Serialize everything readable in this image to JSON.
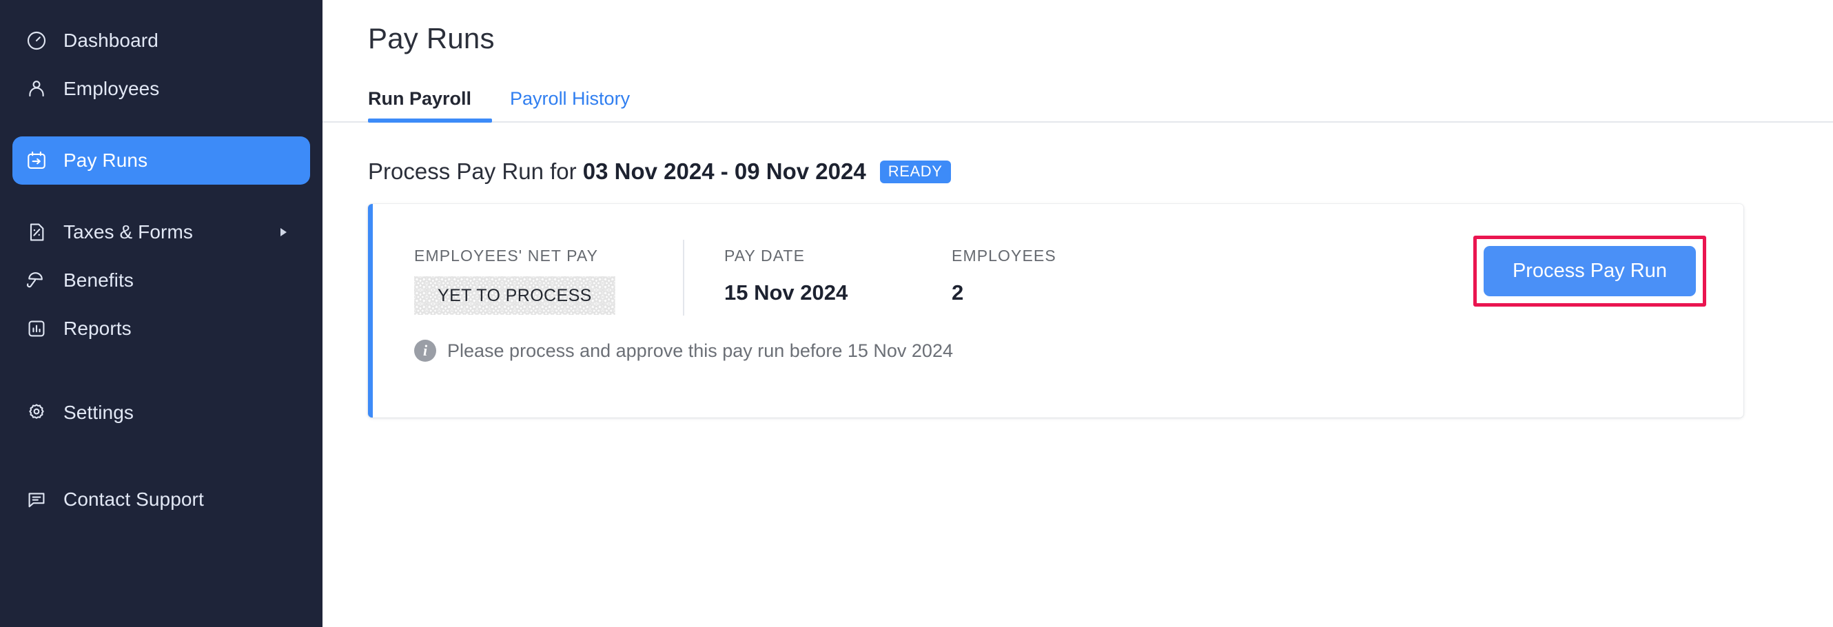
{
  "sidebar": {
    "background_color": "#1e2439",
    "active_color": "#3d8bf8",
    "items": [
      {
        "id": "dashboard",
        "label": "Dashboard",
        "icon": "gauge-icon",
        "active": false,
        "has_caret": false
      },
      {
        "id": "employees",
        "label": "Employees",
        "icon": "person-icon",
        "active": false,
        "has_caret": false
      },
      {
        "id": "pay-runs",
        "label": "Pay Runs",
        "icon": "calendar-arrow-icon",
        "active": true,
        "has_caret": false
      },
      {
        "id": "taxes-forms",
        "label": "Taxes & Forms",
        "icon": "document-percent-icon",
        "active": false,
        "has_caret": true
      },
      {
        "id": "benefits",
        "label": "Benefits",
        "icon": "umbrella-icon",
        "active": false,
        "has_caret": false
      },
      {
        "id": "reports",
        "label": "Reports",
        "icon": "bar-chart-icon",
        "active": false,
        "has_caret": false
      },
      {
        "id": "settings",
        "label": "Settings",
        "icon": "gear-icon",
        "active": false,
        "has_caret": false
      },
      {
        "id": "contact-support",
        "label": "Contact Support",
        "icon": "chat-bubble-icon",
        "active": false,
        "has_caret": false
      }
    ]
  },
  "main": {
    "page_title": "Pay Runs",
    "tabs": [
      {
        "id": "run-payroll",
        "label": "Run Payroll",
        "active": true
      },
      {
        "id": "payroll-history",
        "label": "Payroll History",
        "active": false
      }
    ],
    "section": {
      "heading_prefix": "Process Pay Run for ",
      "heading_period": "03 Nov 2024 - 09 Nov 2024",
      "status_badge": "READY",
      "status_badge_color": "#3d8bf8"
    },
    "card": {
      "accent_color": "#3d8bf8",
      "stats": [
        {
          "id": "net-pay",
          "label": "EMPLOYEES' NET PAY",
          "value": "YET TO PROCESS",
          "type": "pending"
        },
        {
          "id": "pay-date",
          "label": "PAY DATE",
          "value": "15 Nov 2024",
          "type": "text"
        },
        {
          "id": "employees",
          "label": "EMPLOYEES",
          "value": "2",
          "type": "text"
        }
      ],
      "action_button": {
        "label": "Process Pay Run",
        "color": "#4a90f7",
        "highlighted": true,
        "highlight_color": "#ea1550"
      },
      "note": {
        "icon": "info-icon",
        "glyph": "i",
        "text": "Please process and approve this pay run before 15 Nov 2024"
      }
    }
  }
}
